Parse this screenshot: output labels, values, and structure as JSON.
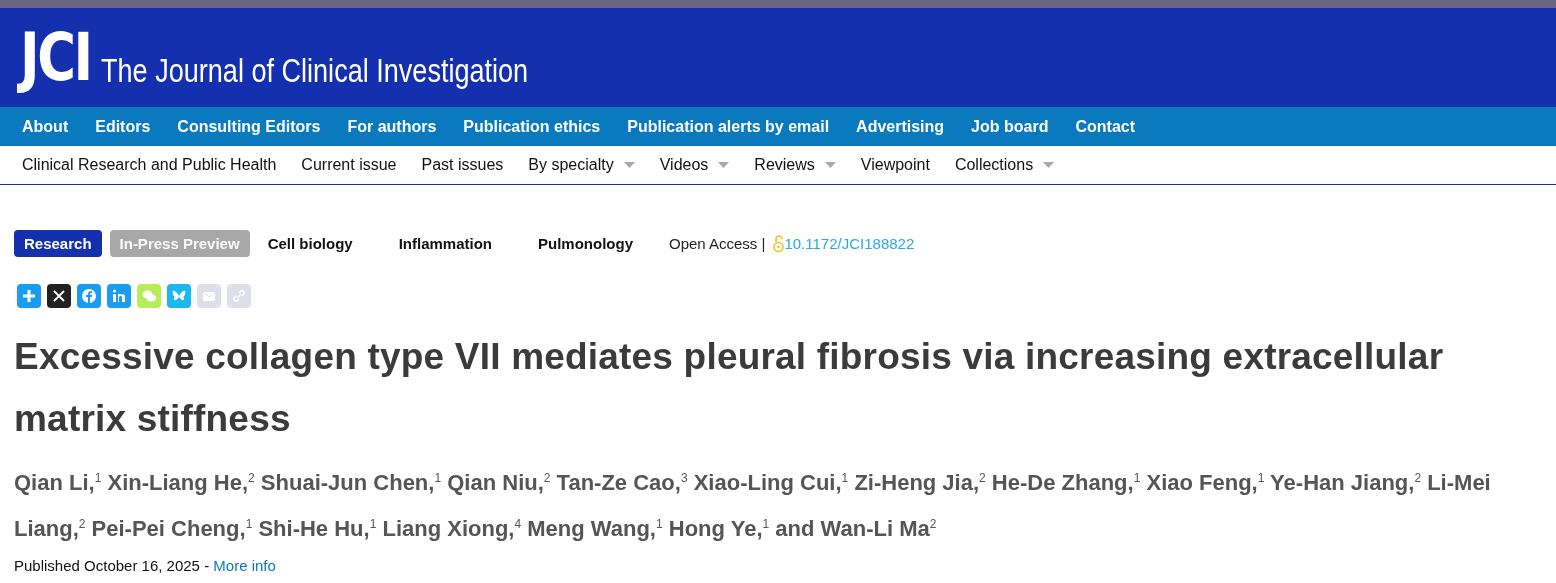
{
  "header": {
    "logo": "JCI",
    "title": "The Journal of Clinical Investigation"
  },
  "primary_nav": [
    "About",
    "Editors",
    "Consulting Editors",
    "For authors",
    "Publication ethics",
    "Publication alerts by email",
    "Advertising",
    "Job board",
    "Contact"
  ],
  "secondary_nav": [
    {
      "label": "Clinical Research and Public Health",
      "dropdown": false
    },
    {
      "label": "Current issue",
      "dropdown": false
    },
    {
      "label": "Past issues",
      "dropdown": false
    },
    {
      "label": "By specialty",
      "dropdown": true
    },
    {
      "label": "Videos",
      "dropdown": true
    },
    {
      "label": "Reviews",
      "dropdown": true
    },
    {
      "label": "Viewpoint",
      "dropdown": false
    },
    {
      "label": "Collections",
      "dropdown": true
    }
  ],
  "tags": [
    {
      "label": "Research",
      "kind": "primary"
    },
    {
      "label": "In-Press Preview",
      "kind": "muted"
    },
    {
      "label": "Cell biology",
      "kind": "plain"
    },
    {
      "label": "Inflammation",
      "kind": "plain"
    },
    {
      "label": "Pulmonology",
      "kind": "plain"
    }
  ],
  "access": {
    "label": "Open Access |",
    "doi": "10.1172/JCI188822"
  },
  "article": {
    "title": "Excessive collagen type VII mediates pleural fibrosis via increasing extracellular matrix stiffness",
    "authors": "Qian Li,$^{1}$ Xin-Liang He,$^{2}$ Shuai-Jun Chen,$^{1}$ Qian Niu,$^{2}$ Tan-Ze Cao,$^{3}$ Xiao-Ling Cui,$^{1}$ Zi-Heng Jia,$^{2}$ He-De Zhang,$^{1}$ Xiao Feng,$^{1}$ Ye-Han Jiang,$^{2}$ Li-Mei Liang,$^{2}$ Pei-Pei Cheng,$^{1}$ Shi-He Hu,$^{1}$ Liang Xiong,$^{4}$ Meng Wang,$^{1}$ Hong Ye,$^{1}$ and Wan-Li Ma$^{2}$",
    "published": "Published October 16, 2025 -",
    "more_info": "More info"
  }
}
